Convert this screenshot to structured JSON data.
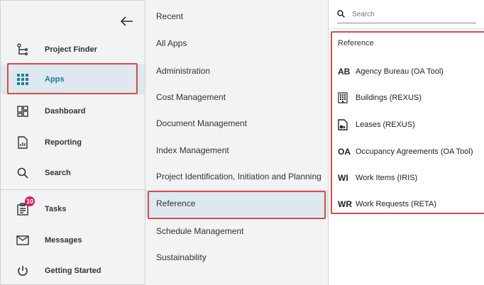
{
  "nav": {
    "items": [
      {
        "label": "Project Finder",
        "icon": "project-finder-icon",
        "active": false
      },
      {
        "label": "Apps",
        "icon": "apps-grid-icon",
        "active": true
      },
      {
        "label": "Dashboard",
        "icon": "dashboard-icon",
        "active": false
      },
      {
        "label": "Reporting",
        "icon": "reporting-icon",
        "active": false
      },
      {
        "label": "Search",
        "icon": "search-icon",
        "active": false
      },
      {
        "label": "Tasks",
        "icon": "tasks-icon",
        "active": false,
        "badge": "10"
      },
      {
        "label": "Messages",
        "icon": "mail-icon",
        "active": false
      },
      {
        "label": "Getting Started",
        "icon": "power-icon",
        "active": false
      }
    ],
    "back_icon": "arrow-left-icon"
  },
  "categories": [
    "Recent",
    "All Apps",
    "Administration",
    "Cost Management",
    "Document Management",
    "Index Management",
    "Project Identification, Initiation and Planning",
    "Reference",
    "Schedule Management",
    "Sustainability"
  ],
  "selected_category": "Reference",
  "search": {
    "placeholder": "Search",
    "value": ""
  },
  "reference": {
    "title": "Reference",
    "apps": [
      {
        "abbr": "AB",
        "name": "Agency Bureau (OA Tool)"
      },
      {
        "abbr": "",
        "icon": "building-icon",
        "name": "Buildings (REXUS)"
      },
      {
        "abbr": "",
        "icon": "lease-document-icon",
        "name": "Leases (REXUS)"
      },
      {
        "abbr": "OA",
        "name": "Occupancy Agreements (OA Tool)"
      },
      {
        "abbr": "WI",
        "name": "Work Items (IRIS)"
      },
      {
        "abbr": "WR",
        "name": "Work Requests (RETA)"
      }
    ]
  },
  "colors": {
    "highlight": "#d94a4a",
    "active_bg": "#dde9ee",
    "active_text": "#1f7a9c",
    "panel_bg": "#f2f3f4",
    "badge": "#d81b60"
  }
}
